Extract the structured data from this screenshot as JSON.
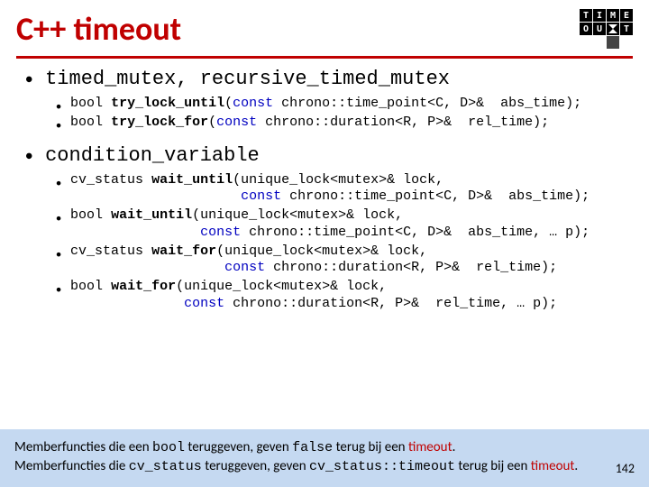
{
  "title": "C++ timeout",
  "logo": {
    "row1": [
      "T",
      "I",
      "M",
      "E"
    ],
    "row3": [
      "O",
      "U",
      "",
      "T"
    ]
  },
  "sections": [
    {
      "heading": "timed_mutex, recursive_timed_mutex",
      "items": [
        "bool <b>try_lock_until</b>(<span class=\"kw\">const</span> chrono::time_point<C, D>&  abs_time);",
        "bool <b>try_lock_for</b>(<span class=\"kw\">const</span> chrono::duration<R, P>&  rel_time);"
      ]
    },
    {
      "heading": "condition_variable",
      "items": [
        "cv_status <b>wait_until</b>(unique_lock<mutex>& lock,\n                     <span class=\"kw\">const</span> chrono::time_point<C, D>&  abs_time);",
        "bool <b>wait_until</b>(unique_lock<mutex>& lock,\n                <span class=\"kw\">const</span> chrono::time_point<C, D>&  abs_time, … p);",
        "cv_status <b>wait_for</b>(unique_lock<mutex>& lock,\n                   <span class=\"kw\">const</span> chrono::duration<R, P>&  rel_time);",
        "bool <b>wait_for</b>(unique_lock<mutex>& lock,\n              <span class=\"kw\">const</span> chrono::duration<R, P>&  rel_time, … p);"
      ]
    }
  ],
  "footer": {
    "line1_a": "Memberfuncties die een ",
    "line1_code1": "bool",
    "line1_b": " teruggeven, geven ",
    "line1_code2": "false",
    "line1_c": " terug bij een ",
    "line1_red": "timeout",
    "line1_d": ".",
    "line2_a": "Memberfuncties die ",
    "line2_code1": "cv_status",
    "line2_b": " teruggeven, geven ",
    "line2_code2": "cv_status::timeout",
    "line2_c": " terug bij een ",
    "line2_red": "timeout",
    "line2_d": "."
  },
  "page_number": "142"
}
